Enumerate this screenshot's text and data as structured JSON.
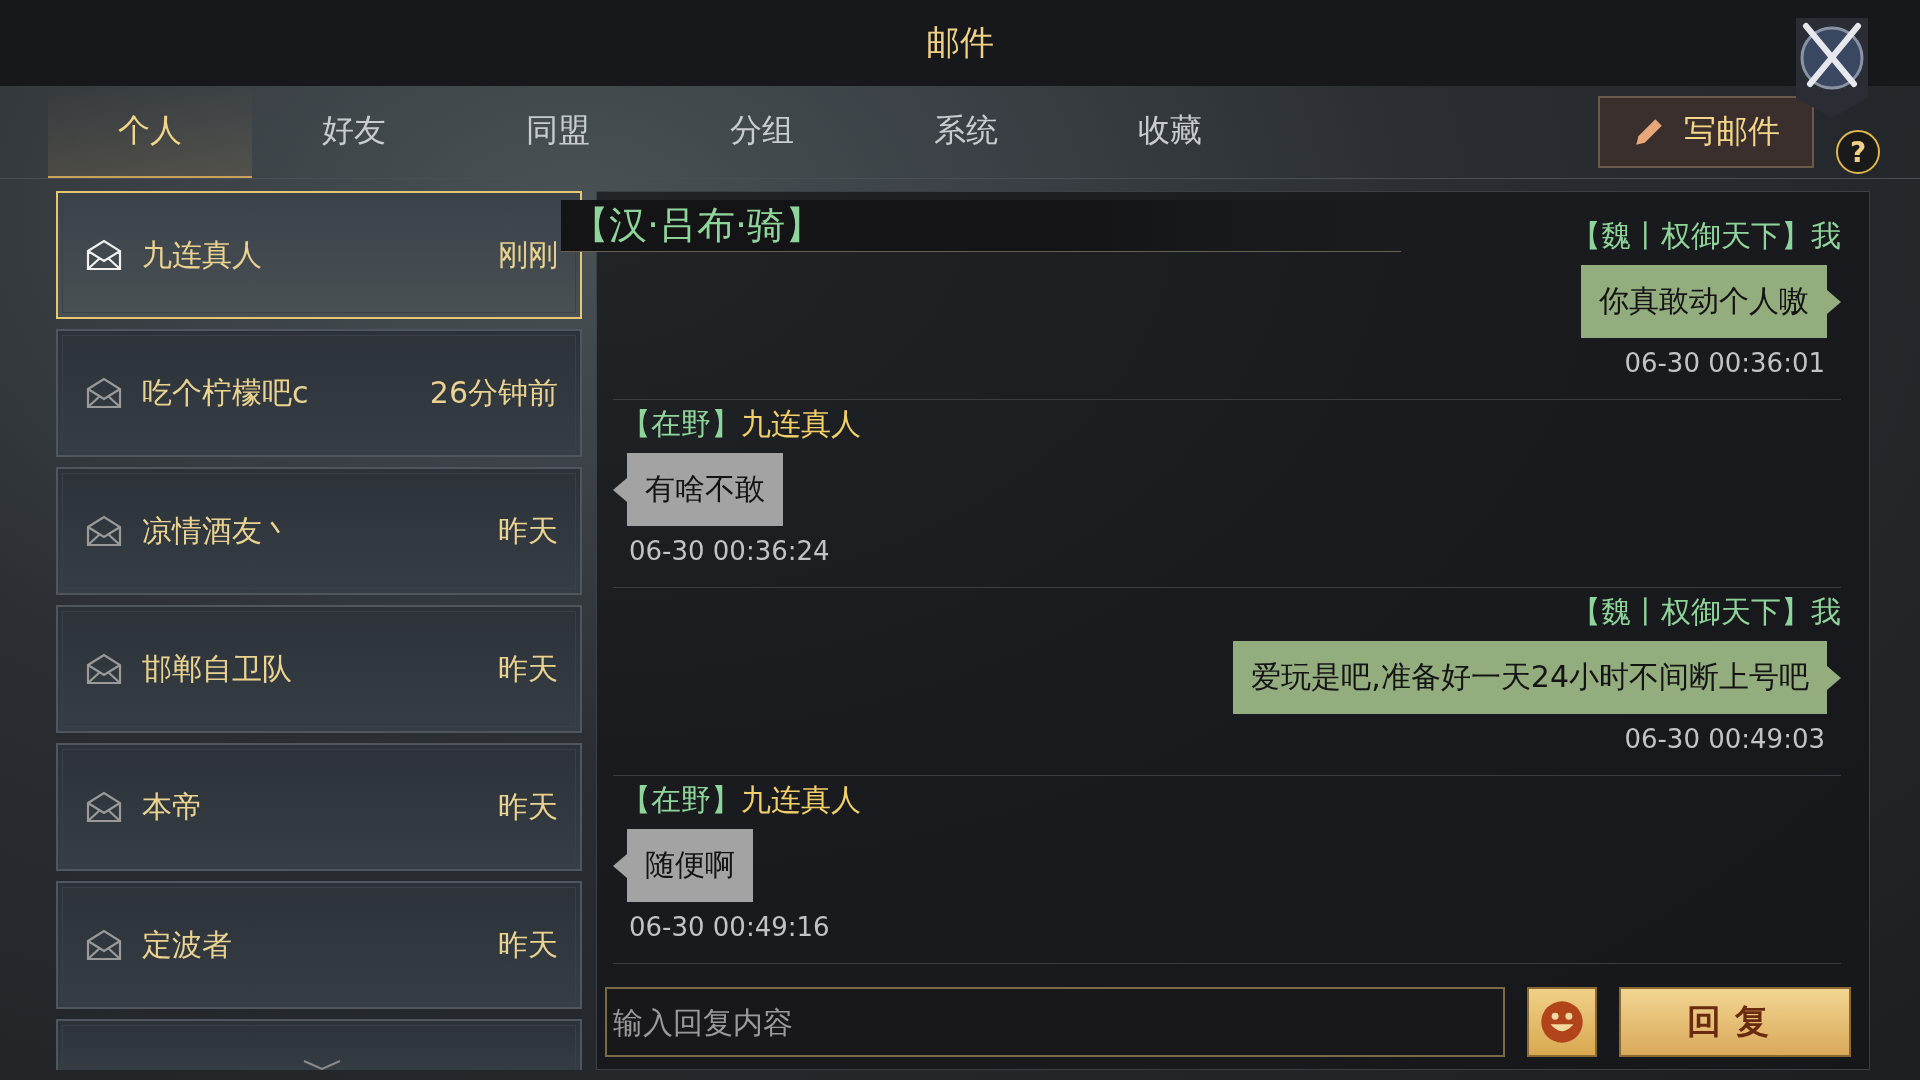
{
  "window": {
    "title": "邮件"
  },
  "tabs": [
    {
      "label": "个人",
      "selected": true
    },
    {
      "label": "好友",
      "selected": false
    },
    {
      "label": "同盟",
      "selected": false
    },
    {
      "label": "分组",
      "selected": false
    },
    {
      "label": "系统",
      "selected": false
    },
    {
      "label": "收藏",
      "selected": false
    }
  ],
  "compose_button": {
    "label": "写邮件"
  },
  "help_button": {
    "label": "?"
  },
  "mail_list": [
    {
      "name": "九连真人",
      "time": "刚刚",
      "selected": true
    },
    {
      "name": "吃个柠檬吧c",
      "time": "26分钟前",
      "selected": false
    },
    {
      "name": "凉情酒友丶",
      "time": "昨天",
      "selected": false
    },
    {
      "name": "邯郸自卫队",
      "time": "昨天",
      "selected": false
    },
    {
      "name": "本帝",
      "time": "昨天",
      "selected": false
    },
    {
      "name": "定波者",
      "time": "昨天",
      "selected": false
    }
  ],
  "conversation": {
    "header": "【汉·吕布·骑】",
    "messages": [
      {
        "kind": "sent",
        "tag": "【魏丨权御天下】",
        "name": "我",
        "text": "你真敢动个人嗷",
        "time": "06-30 00:36:01"
      },
      {
        "kind": "received",
        "tag": "【在野】",
        "name": "九连真人",
        "text": "有啥不敢",
        "time": "06-30 00:36:24"
      },
      {
        "kind": "sent",
        "tag": "【魏丨权御天下】",
        "name": "我",
        "text": "爱玩是吧,准备好一天24小时不间断上号吧",
        "time": "06-30 00:49:03"
      },
      {
        "kind": "received",
        "tag": "【在野】",
        "name": "九连真人",
        "text": "随便啊",
        "time": "06-30 00:49:16"
      }
    ]
  },
  "reply": {
    "placeholder": "输入回复内容",
    "button": "回复"
  }
}
